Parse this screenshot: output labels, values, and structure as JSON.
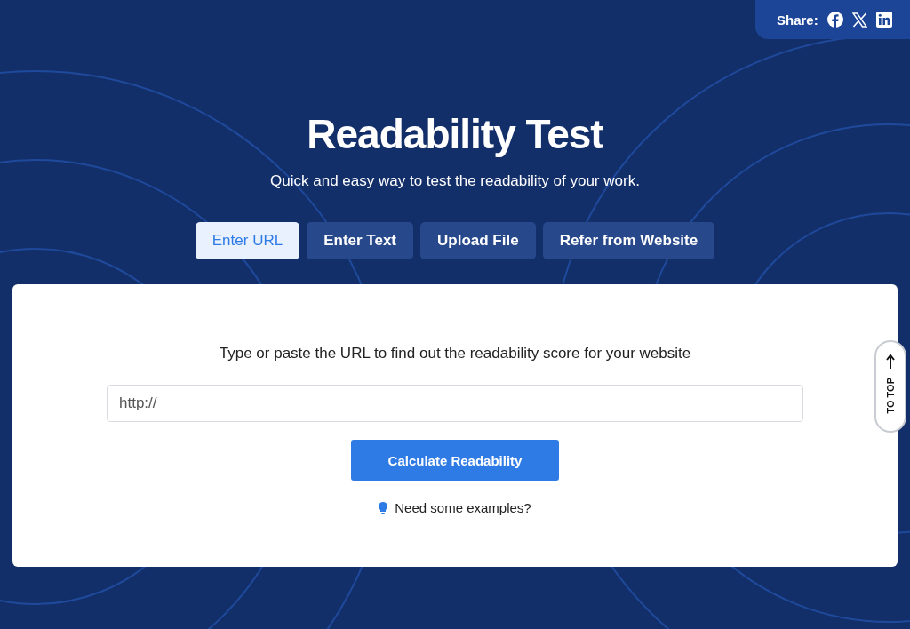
{
  "share": {
    "label": "Share:"
  },
  "header": {
    "title": "Readability Test",
    "subtitle": "Quick and easy way to test the readability of your work."
  },
  "tabs": [
    {
      "label": "Enter URL",
      "selected": true
    },
    {
      "label": "Enter Text",
      "selected": false
    },
    {
      "label": "Upload File",
      "selected": false
    },
    {
      "label": "Refer from Website",
      "selected": false
    }
  ],
  "form": {
    "prompt": "Type or paste the URL to find out the readability score for your website",
    "url_field": {
      "placeholder": "http://"
    },
    "submit": "Calculate Readability",
    "help_link": "Need some examples?"
  },
  "to_top": {
    "label": "TO TOP"
  }
}
